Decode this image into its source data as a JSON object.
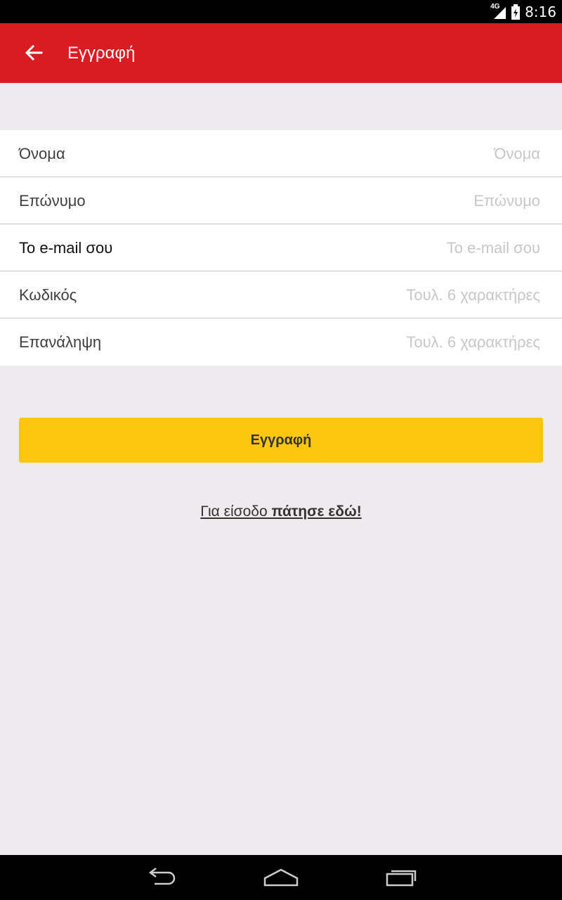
{
  "status_bar": {
    "network": "4G",
    "time": "8:16"
  },
  "app_bar": {
    "title": "Εγγραφή",
    "back_icon": "arrow-back-icon"
  },
  "form": {
    "fields": [
      {
        "label": "Όνομα",
        "placeholder": "Όνομα",
        "value": ""
      },
      {
        "label": "Επώνυμο",
        "placeholder": "Επώνυμο",
        "value": ""
      },
      {
        "label": "Το e-mail σου",
        "placeholder": "Το e-mail σου",
        "value": ""
      },
      {
        "label": "Κωδικός",
        "placeholder": "Τουλ. 6 χαρακτήρες",
        "value": ""
      },
      {
        "label": "Επανάληψη",
        "placeholder": "Τουλ. 6 χαρακτήρες",
        "value": ""
      }
    ]
  },
  "submit": {
    "label": "Εγγραφή"
  },
  "login": {
    "prefix": "Για είσοδο ",
    "link": "πάτησε εδώ!"
  },
  "nav_bar": {
    "icons": [
      "back-icon",
      "home-icon",
      "recents-icon"
    ]
  },
  "colors": {
    "app_bar": "#DA1C22",
    "accent_button": "#FEC60F",
    "background": "#EEEAED"
  }
}
